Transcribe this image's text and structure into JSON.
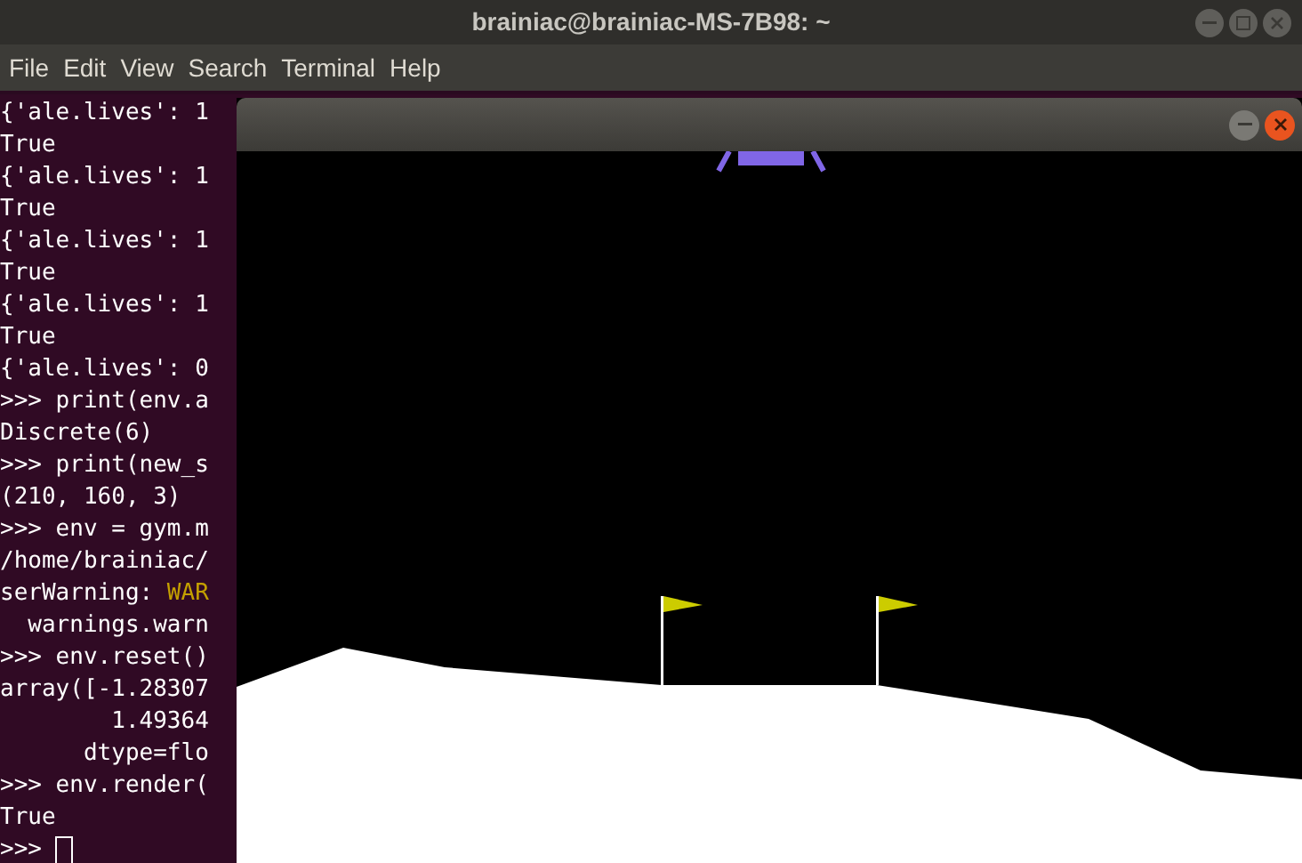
{
  "window": {
    "title": "brainiac@brainiac-MS-7B98: ~"
  },
  "menu": [
    "File",
    "Edit",
    "View",
    "Search",
    "Terminal",
    "Help"
  ],
  "terminal_lines": [
    {
      "kind": "output",
      "text": "{'ale.lives': 1"
    },
    {
      "kind": "output",
      "text": "True"
    },
    {
      "kind": "output",
      "text": "{'ale.lives': 1"
    },
    {
      "kind": "output",
      "text": "True"
    },
    {
      "kind": "output",
      "text": "{'ale.lives': 1"
    },
    {
      "kind": "output",
      "text": "True"
    },
    {
      "kind": "output",
      "text": "{'ale.lives': 1"
    },
    {
      "kind": "output",
      "text": "True"
    },
    {
      "kind": "output",
      "text": "{'ale.lives': 0"
    },
    {
      "kind": "output",
      "text": ">>> print(env.a"
    },
    {
      "kind": "output",
      "text": "Discrete(6)"
    },
    {
      "kind": "output",
      "text": ">>> print(new_s"
    },
    {
      "kind": "output",
      "text": "(210, 160, 3)"
    },
    {
      "kind": "output",
      "text": ">>> env = gym.m"
    },
    {
      "kind": "output",
      "text": "/home/brainiac/"
    },
    {
      "kind": "warning",
      "text": "serWarning: ",
      "warning": "WAR"
    },
    {
      "kind": "output",
      "text": "  warnings.warn"
    },
    {
      "kind": "output",
      "text": ">>> env.reset()"
    },
    {
      "kind": "output",
      "text": "array([-1.28307"
    },
    {
      "kind": "output",
      "text": "        1.49364"
    },
    {
      "kind": "output",
      "text": "      dtype=flo"
    },
    {
      "kind": "output",
      "text": ">>> env.render("
    },
    {
      "kind": "output",
      "text": "True"
    },
    {
      "kind": "prompt",
      "text": ">>> "
    }
  ]
}
